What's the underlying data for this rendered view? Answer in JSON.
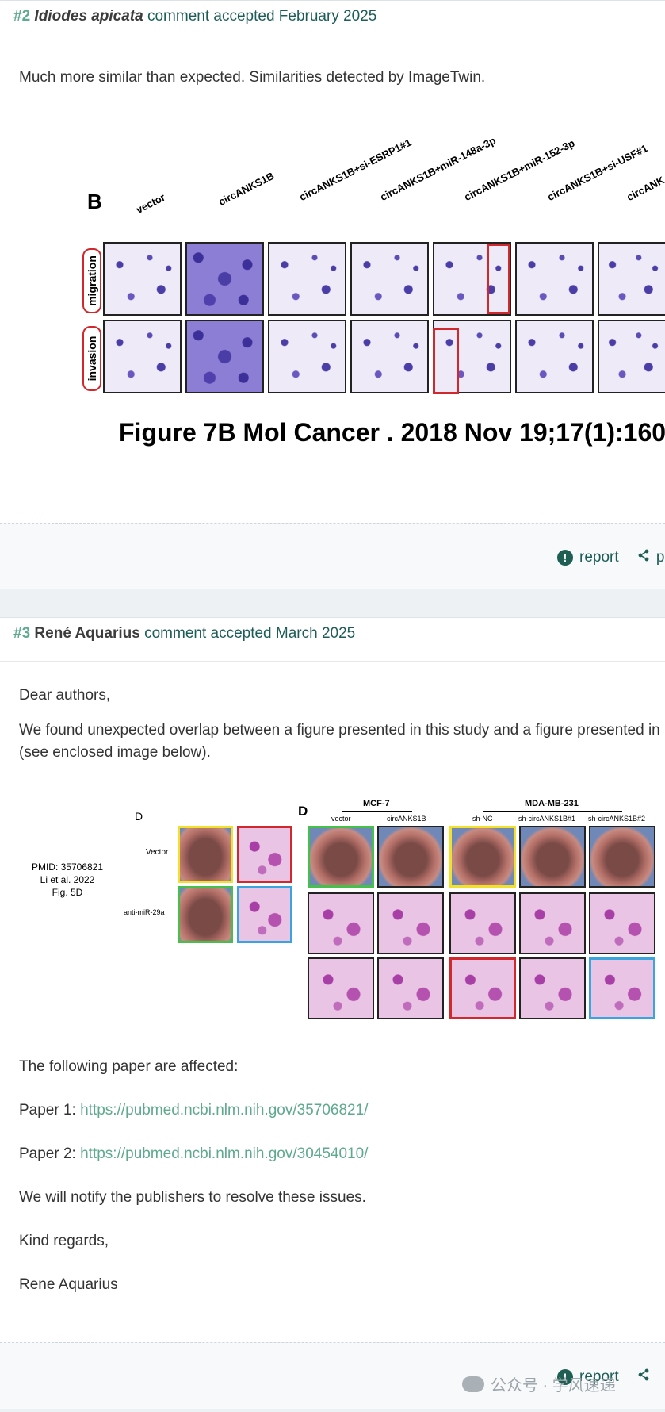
{
  "comment2": {
    "number": "#2",
    "author": "Idiodes apicata",
    "meta": "comment accepted February 2025",
    "text": "Much more similar than expected. Similarities detected by ImageTwin.",
    "figure": {
      "panel_label": "B",
      "columns": [
        "vector",
        "circANKS1B",
        "circANKS1B+si-ESRP1#1",
        "circANKS1B+miR-148a-3p",
        "circANKS1B+miR-152-3p",
        "circANKS1B+si-USF#1",
        "circANK"
      ],
      "rows": [
        "migration",
        "invasion"
      ],
      "caption": "Figure 7B Mol Cancer . 2018 Nov 19;17(1):160."
    },
    "footer": {
      "report_label": "report",
      "share_label": "p"
    }
  },
  "comment3": {
    "number": "#3",
    "author": "René Aquarius",
    "meta": "comment accepted March 2025",
    "greeting": "Dear authors,",
    "para_line1": "We found unexpected overlap between a figure presented in this study and a figure presented in",
    "para_line2": "(see enclosed image below).",
    "figure": {
      "pmid_line1": "PMID: 35706821",
      "pmid_line2": "Li et al. 2022",
      "pmid_line3": "Fig. 5D",
      "left_label": "D",
      "left_row1": "Vector",
      "left_row2": "anti-miR-29a",
      "right_label": "D",
      "group1": "MCF-7",
      "group2": "MDA-MB-231",
      "cols": [
        "vector",
        "circANKS1B",
        "sh-NC",
        "sh-circANKS1B#1",
        "sh-circANKS1B#2"
      ]
    },
    "affected": "The following paper are affected:",
    "paper1_prefix": "Paper 1: ",
    "paper1_link": "https://pubmed.ncbi.nlm.nih.gov/35706821/",
    "paper2_prefix": "Paper 2: ",
    "paper2_link": "https://pubmed.ncbi.nlm.nih.gov/30454010/",
    "notify": "We will notify the publishers to resolve these issues.",
    "closing": "Kind regards,",
    "signature": "Rene Aquarius",
    "footer": {
      "report_label": "report"
    }
  },
  "watermark": "公众号 · 学风速递",
  "icons": {
    "report": "alert-circle-icon",
    "share": "share-icon",
    "watermark": "wechat-icon"
  },
  "colors": {
    "accent": "#5fa98e",
    "link": "#5fa98e",
    "header_text": "#1d5d57",
    "highlight_red": "#d0282c"
  }
}
